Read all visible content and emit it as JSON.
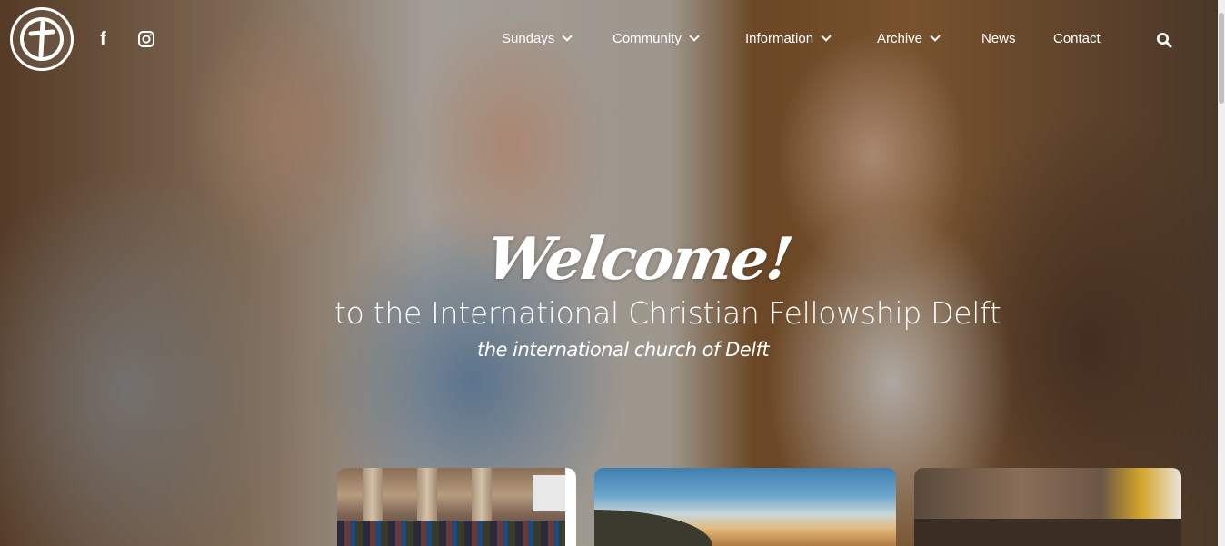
{
  "header": {
    "logo_alt": "ICF Delft logo",
    "social": {
      "facebook": "f",
      "instagram": "instagram"
    },
    "nav": [
      {
        "label": "Sundays",
        "has_dropdown": true
      },
      {
        "label": "Community",
        "has_dropdown": true
      },
      {
        "label": "Information",
        "has_dropdown": true
      },
      {
        "label": "Archive",
        "has_dropdown": true
      },
      {
        "label": "News",
        "has_dropdown": false
      },
      {
        "label": "Contact",
        "has_dropdown": false
      }
    ],
    "search_icon": "search-icon"
  },
  "hero": {
    "title": "Welcome!",
    "subtitle": "to the International Christian Fellowship Delft",
    "tagline": "the international church of Delft"
  },
  "cards": [
    {
      "image": "church-congregation-photo"
    },
    {
      "image": "sky-landscape-photo"
    },
    {
      "image": "study-group-photo"
    }
  ],
  "colors": {
    "text": "#ffffff"
  }
}
